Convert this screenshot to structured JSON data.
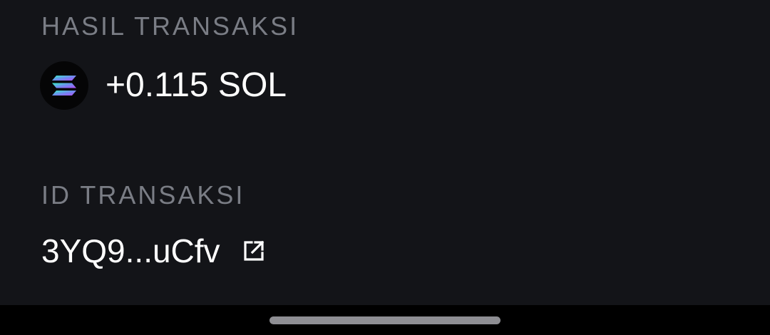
{
  "result": {
    "label": "HASIL TRANSAKSI",
    "amount": "+0.115 SOL",
    "token_icon": "solana-logo-icon"
  },
  "transaction": {
    "label": "ID TRANSAKSI",
    "id_short": "3YQ9...uCfv",
    "link_icon": "external-link-icon"
  },
  "colors": {
    "background": "#131418",
    "label_text": "#7a7d85",
    "primary_text": "#ffffff",
    "nav_bar": "#000000",
    "home_indicator": "#8e8e93"
  }
}
